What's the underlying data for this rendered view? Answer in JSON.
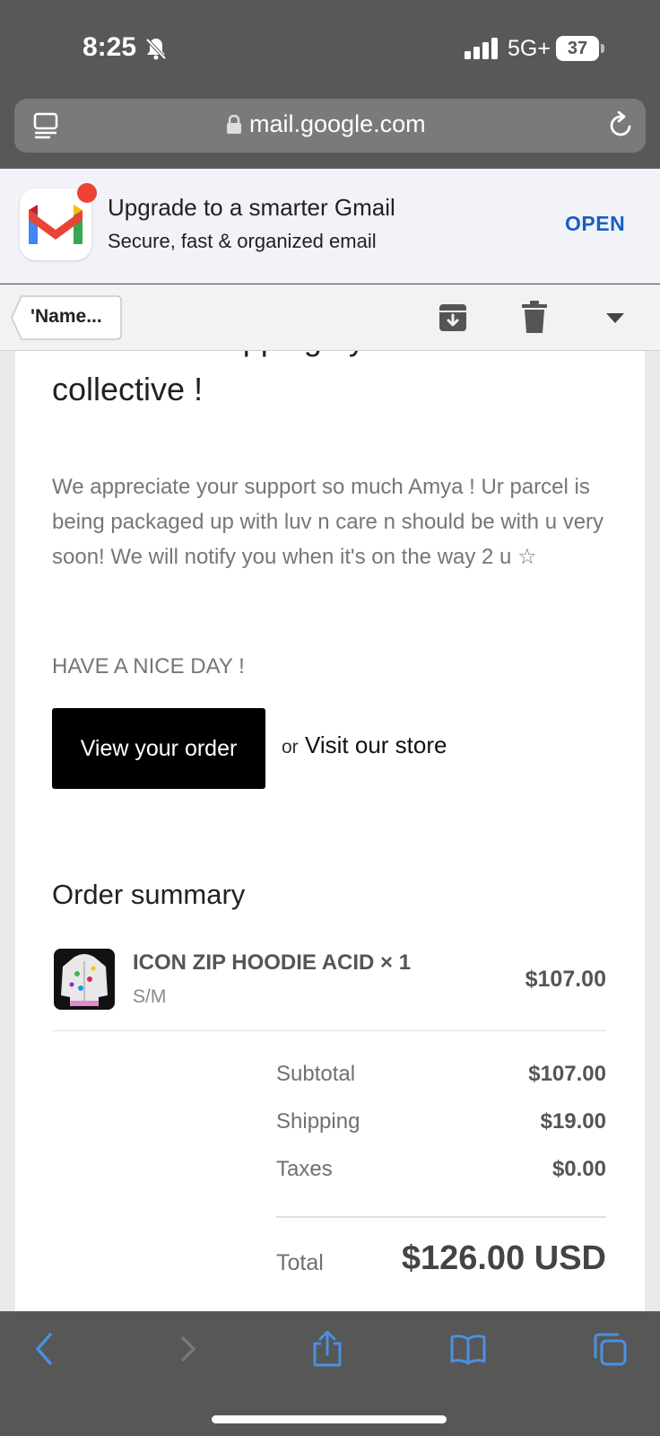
{
  "status_bar": {
    "time": "8:25",
    "network": "5G+",
    "battery": "37"
  },
  "browser": {
    "url": "mail.google.com"
  },
  "banner": {
    "title": "Upgrade to a smarter Gmail",
    "subtitle": "Secure, fast & organized email",
    "open_label": "OPEN"
  },
  "toolbar": {
    "back_label": "'Name..."
  },
  "email": {
    "heading_line1": "THANK Y stopping by at HAILED",
    "heading_line2": "collective !",
    "paragraph": "We appreciate your support so much Amya ! Ur parcel is being packaged up with luv n care n should be with u very soon! We will notify you when it's on the way 2 u ☆",
    "sign_off": "HAVE A NICE DAY !",
    "view_order_label": "View your order",
    "or_text": "or",
    "visit_store_label": "Visit our store"
  },
  "order_summary": {
    "title": "Order summary",
    "item": {
      "name": "ICON ZIP HOODIE ACID × 1",
      "variant": "S/M",
      "price": "$107.00"
    },
    "subtotal_label": "Subtotal",
    "subtotal": "$107.00",
    "shipping_label": "Shipping",
    "shipping": "$19.00",
    "taxes_label": "Taxes",
    "taxes": "$0.00",
    "total_label": "Total",
    "total": "$126.00 USD"
  },
  "colors": {
    "accent_blue": "#1a5fbf",
    "safari_blue": "#4a90e2",
    "gmail_red": "#ea4335"
  }
}
